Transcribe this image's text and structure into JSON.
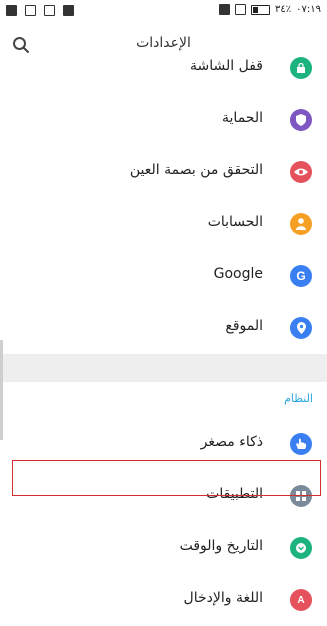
{
  "status_bar": {
    "time": "٠٧:١٩",
    "battery": "٣٤٪"
  },
  "header": {
    "title": "الإعدادات"
  },
  "items": [
    {
      "label": "قفل الشاشة",
      "icon": "lock-icon",
      "color": "#1db37e"
    },
    {
      "label": "الحماية",
      "icon": "shield-icon",
      "color": "#7e57c2"
    },
    {
      "label": "التحقق من بصمة العين",
      "icon": "eye-icon",
      "color": "#e5525c"
    },
    {
      "label": "الحسابات",
      "icon": "person-icon",
      "color": "#f5a025"
    },
    {
      "label": "Google",
      "icon": "google-icon",
      "color": "#3a7ff2"
    },
    {
      "label": "الموقع",
      "icon": "location-icon",
      "color": "#3a7ff2"
    }
  ],
  "section_title": "النظام",
  "system_items": [
    {
      "label": "ذكاء مصغر",
      "icon": "hand-icon",
      "color": "#3a7ff2"
    },
    {
      "label": "التطبيقات",
      "icon": "apps-icon",
      "color": "#7a8a9a"
    },
    {
      "label": "التاريخ والوقت",
      "icon": "clock-icon",
      "color": "#1db37e"
    },
    {
      "label": "اللغة والإدخال",
      "icon": "language-icon",
      "color": "#e5525c"
    }
  ]
}
